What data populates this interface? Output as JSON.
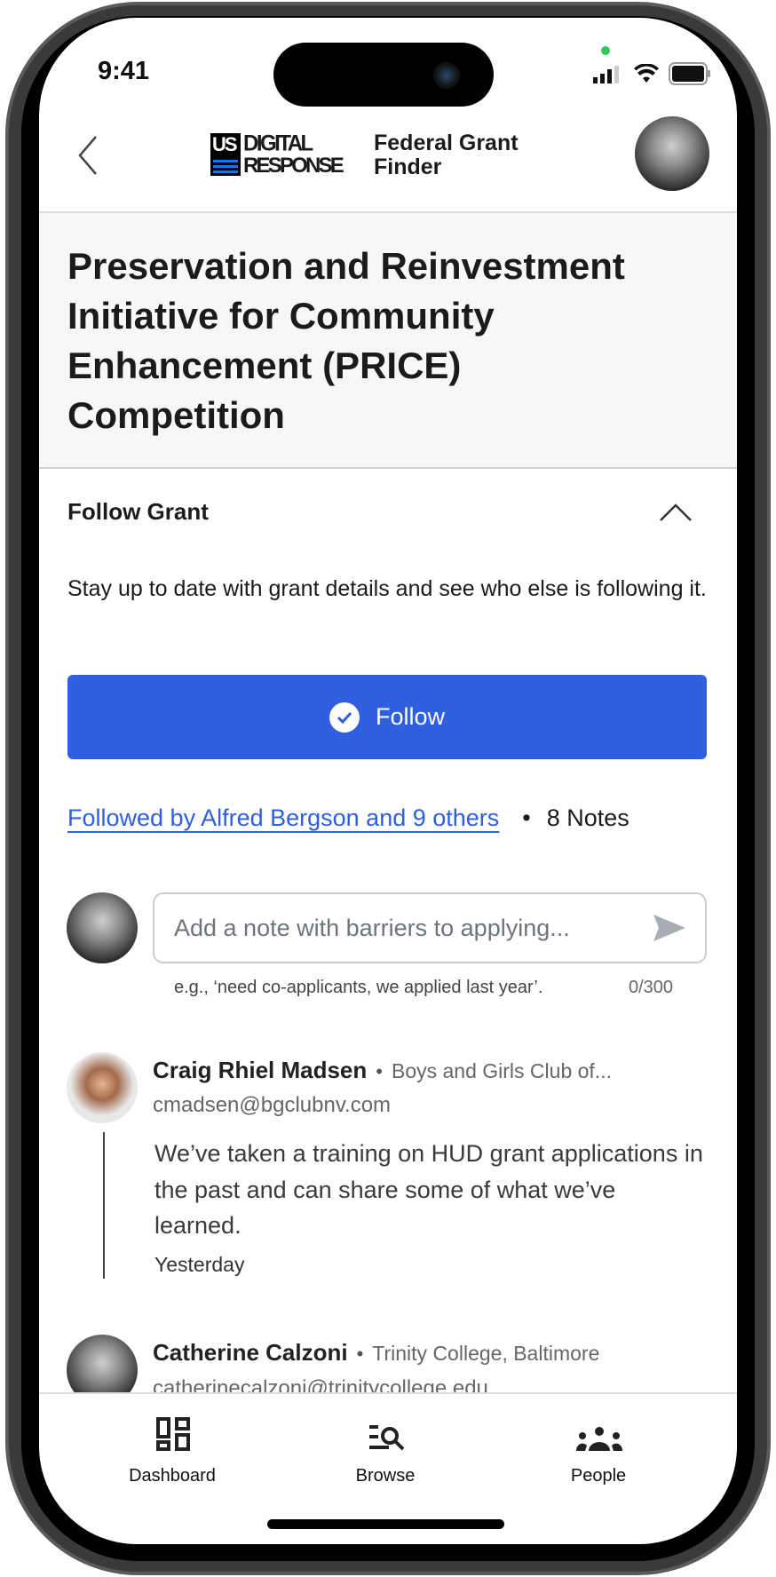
{
  "status_bar": {
    "time": "9:41"
  },
  "header": {
    "logo_top": "US",
    "logo_line1": "DIGITAL",
    "logo_line2": "RESPONSE",
    "app_title_line1": "Federal Grant",
    "app_title_line2": "Finder"
  },
  "grant": {
    "title": "Preservation and Reinvestment Initiative for Community Enhancement (PRICE) Competition"
  },
  "follow": {
    "section_title": "Follow Grant",
    "description": "Stay up to date with grant details and see who else is following it.",
    "button_label": "Follow",
    "followers_link": "Followed by Alfred Bergson and 9 others",
    "notes_count": "8 Notes",
    "accent": "#2f5edf"
  },
  "note_input": {
    "placeholder": "Add a note with barriers to applying...",
    "hint": "e.g., ‘need co-applicants, we applied last year’.",
    "counter": "0/300"
  },
  "comments": [
    {
      "name": "Craig Rhiel Madsen",
      "org": "Boys and Girls Club of...",
      "email": "cmadsen@bgclubnv.com",
      "body": "We’ve taken a training on HUD grant applications in the past and can share some of what we’ve learned.",
      "time": "Yesterday"
    },
    {
      "name": "Catherine Calzoni",
      "org": "Trinity College, Baltimore",
      "email": "catherinecalzoni@trinitycollege.edu"
    }
  ],
  "nav": [
    {
      "label": "Dashboard",
      "icon": "dashboard-icon"
    },
    {
      "label": "Browse",
      "icon": "browse-search-icon"
    },
    {
      "label": "People",
      "icon": "people-icon"
    }
  ]
}
